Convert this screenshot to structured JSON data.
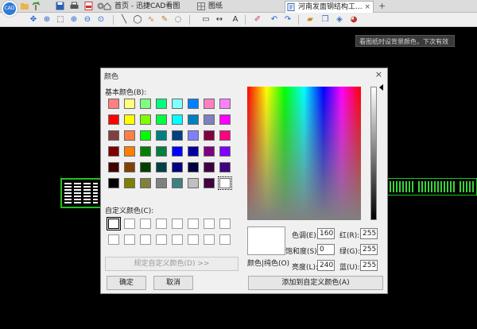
{
  "tabs": [
    {
      "label": "首页 - 迅捷CAD看图",
      "active": false
    },
    {
      "label": "图纸",
      "active": false
    },
    {
      "label": "河南发面钢结构工...",
      "active": true
    }
  ],
  "canvas_hint": "看图纸时设背景颜色，下次有效",
  "dialog": {
    "title": "颜色",
    "basic_label": "基本颜色(B):",
    "custom_label": "自定义颜色(C):",
    "define_custom_btn": "规定自定义颜色(D) >>",
    "ok_btn": "确定",
    "cancel_btn": "取消",
    "add_custom_btn": "添加到自定义颜色(A)",
    "color_solid_label": "颜色|纯色(O)",
    "hue_label": "色调(E):",
    "hue_value": "160",
    "sat_label": "饱和度(S):",
    "sat_value": "0",
    "lum_label": "亮度(L):",
    "lum_value": "240",
    "red_label": "红(R):",
    "red_value": "255",
    "green_label": "绿(G):",
    "green_value": "255",
    "blue_label": "蓝(U):",
    "blue_value": "255",
    "basic_colors": [
      [
        "#ff8080",
        "#ffff80",
        "#80ff80",
        "#00ff80",
        "#80ffff",
        "#0080ff",
        "#ff80c0",
        "#ff80ff"
      ],
      [
        "#ff0000",
        "#ffff00",
        "#80ff00",
        "#00ff40",
        "#00ffff",
        "#0080c0",
        "#8080c0",
        "#ff00ff"
      ],
      [
        "#804040",
        "#ff8040",
        "#00ff00",
        "#008080",
        "#004080",
        "#8080ff",
        "#800040",
        "#ff0080"
      ],
      [
        "#800000",
        "#ff8000",
        "#008000",
        "#008040",
        "#0000ff",
        "#0000a0",
        "#800080",
        "#8000ff"
      ],
      [
        "#400000",
        "#804000",
        "#004000",
        "#004040",
        "#000080",
        "#000040",
        "#400040",
        "#400080"
      ],
      [
        "#000000",
        "#808000",
        "#808040",
        "#808080",
        "#408080",
        "#c0c0c0",
        "#400040",
        "#ffffff"
      ]
    ],
    "selected_basic": "#ffffff"
  }
}
